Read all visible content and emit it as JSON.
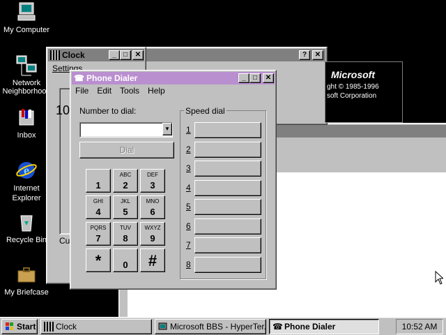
{
  "colors": {
    "desktop": "#000000",
    "active_title": "#b98fd0",
    "inactive_title": "#808080",
    "face": "#c0c0c0"
  },
  "desktop_icons": [
    {
      "label": "My Computer",
      "icon": "my-computer-icon"
    },
    {
      "label": "Network Neighborhood",
      "icon": "network-neighborhood-icon"
    },
    {
      "label": "Inbox",
      "icon": "inbox-icon"
    },
    {
      "label": "Internet Explorer",
      "icon": "internet-explorer-icon"
    },
    {
      "label": "Recycle Bin",
      "icon": "recycle-bin-icon"
    },
    {
      "label": "My Briefcase",
      "icon": "briefcase-icon"
    }
  ],
  "clock_window": {
    "title": "Clock",
    "menu": "Settings",
    "time_partial": "10",
    "cut_text": "Cur"
  },
  "about_window": {
    "brand": "Microsoft",
    "line1": "ght © 1985-1996",
    "line2": "soft Corporation"
  },
  "phone_dialer": {
    "title": "Phone Dialer",
    "menu": [
      "File",
      "Edit",
      "Tools",
      "Help"
    ],
    "number_label": "Number to dial:",
    "number_value": "",
    "dial_button": "Dial",
    "speed_dial_label": "Speed dial",
    "keys": [
      {
        "digit": "1",
        "letters": ""
      },
      {
        "digit": "2",
        "letters": "ABC"
      },
      {
        "digit": "3",
        "letters": "DEF"
      },
      {
        "digit": "4",
        "letters": "GHI"
      },
      {
        "digit": "5",
        "letters": "JKL"
      },
      {
        "digit": "6",
        "letters": "MNO"
      },
      {
        "digit": "7",
        "letters": "PQRS"
      },
      {
        "digit": "8",
        "letters": "TUV"
      },
      {
        "digit": "9",
        "letters": "WXYZ"
      },
      {
        "digit": "*",
        "letters": ""
      },
      {
        "digit": "0",
        "letters": ""
      },
      {
        "digit": "#",
        "letters": ""
      }
    ],
    "speed_dial": [
      {
        "num": "1",
        "name": ""
      },
      {
        "num": "2",
        "name": ""
      },
      {
        "num": "3",
        "name": ""
      },
      {
        "num": "4",
        "name": ""
      },
      {
        "num": "5",
        "name": ""
      },
      {
        "num": "6",
        "name": ""
      },
      {
        "num": "7",
        "name": ""
      },
      {
        "num": "8",
        "name": ""
      }
    ]
  },
  "taskbar": {
    "start": "Start",
    "items": [
      {
        "label": "Clock",
        "active": false
      },
      {
        "label": "Microsoft BBS - HyperTer...",
        "active": false
      },
      {
        "label": "Phone Dialer",
        "active": true
      }
    ],
    "time": "10:52 AM"
  }
}
